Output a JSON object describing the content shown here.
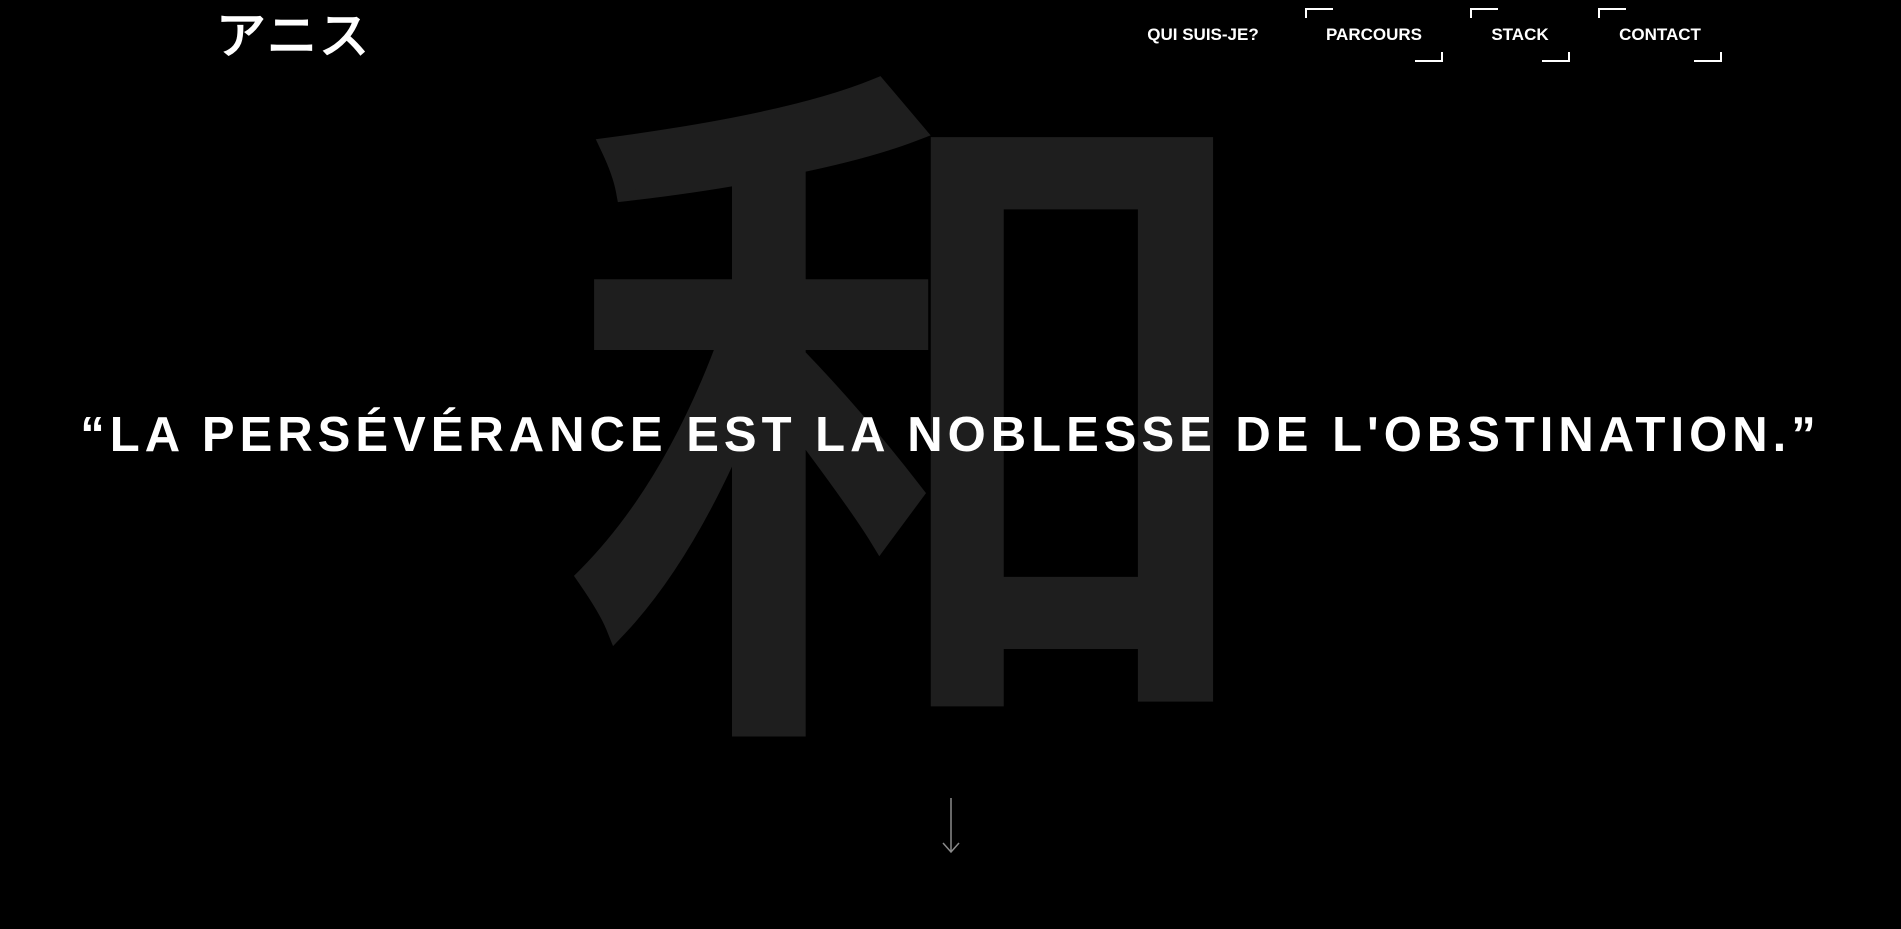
{
  "logo": {
    "text": "アニス"
  },
  "nav": {
    "items": [
      {
        "label": "QUI SUIS-JE?"
      },
      {
        "label": "PARCOURS"
      },
      {
        "label": "STACK"
      },
      {
        "label": "CONTACT"
      }
    ]
  },
  "hero": {
    "kanji": "和",
    "quote": {
      "open": "“LA ",
      "emphasis": "PERSÉVÉRANCE",
      "rest": " EST LA NOBLESSE DE L'OBSTINATION.”"
    }
  },
  "scroll_indicator": {
    "icon": "arrow-down-icon"
  },
  "colors": {
    "background": "#000000",
    "text": "#ffffff",
    "kanji": "#1e1e1e",
    "arrow": "#8a8a8a"
  }
}
